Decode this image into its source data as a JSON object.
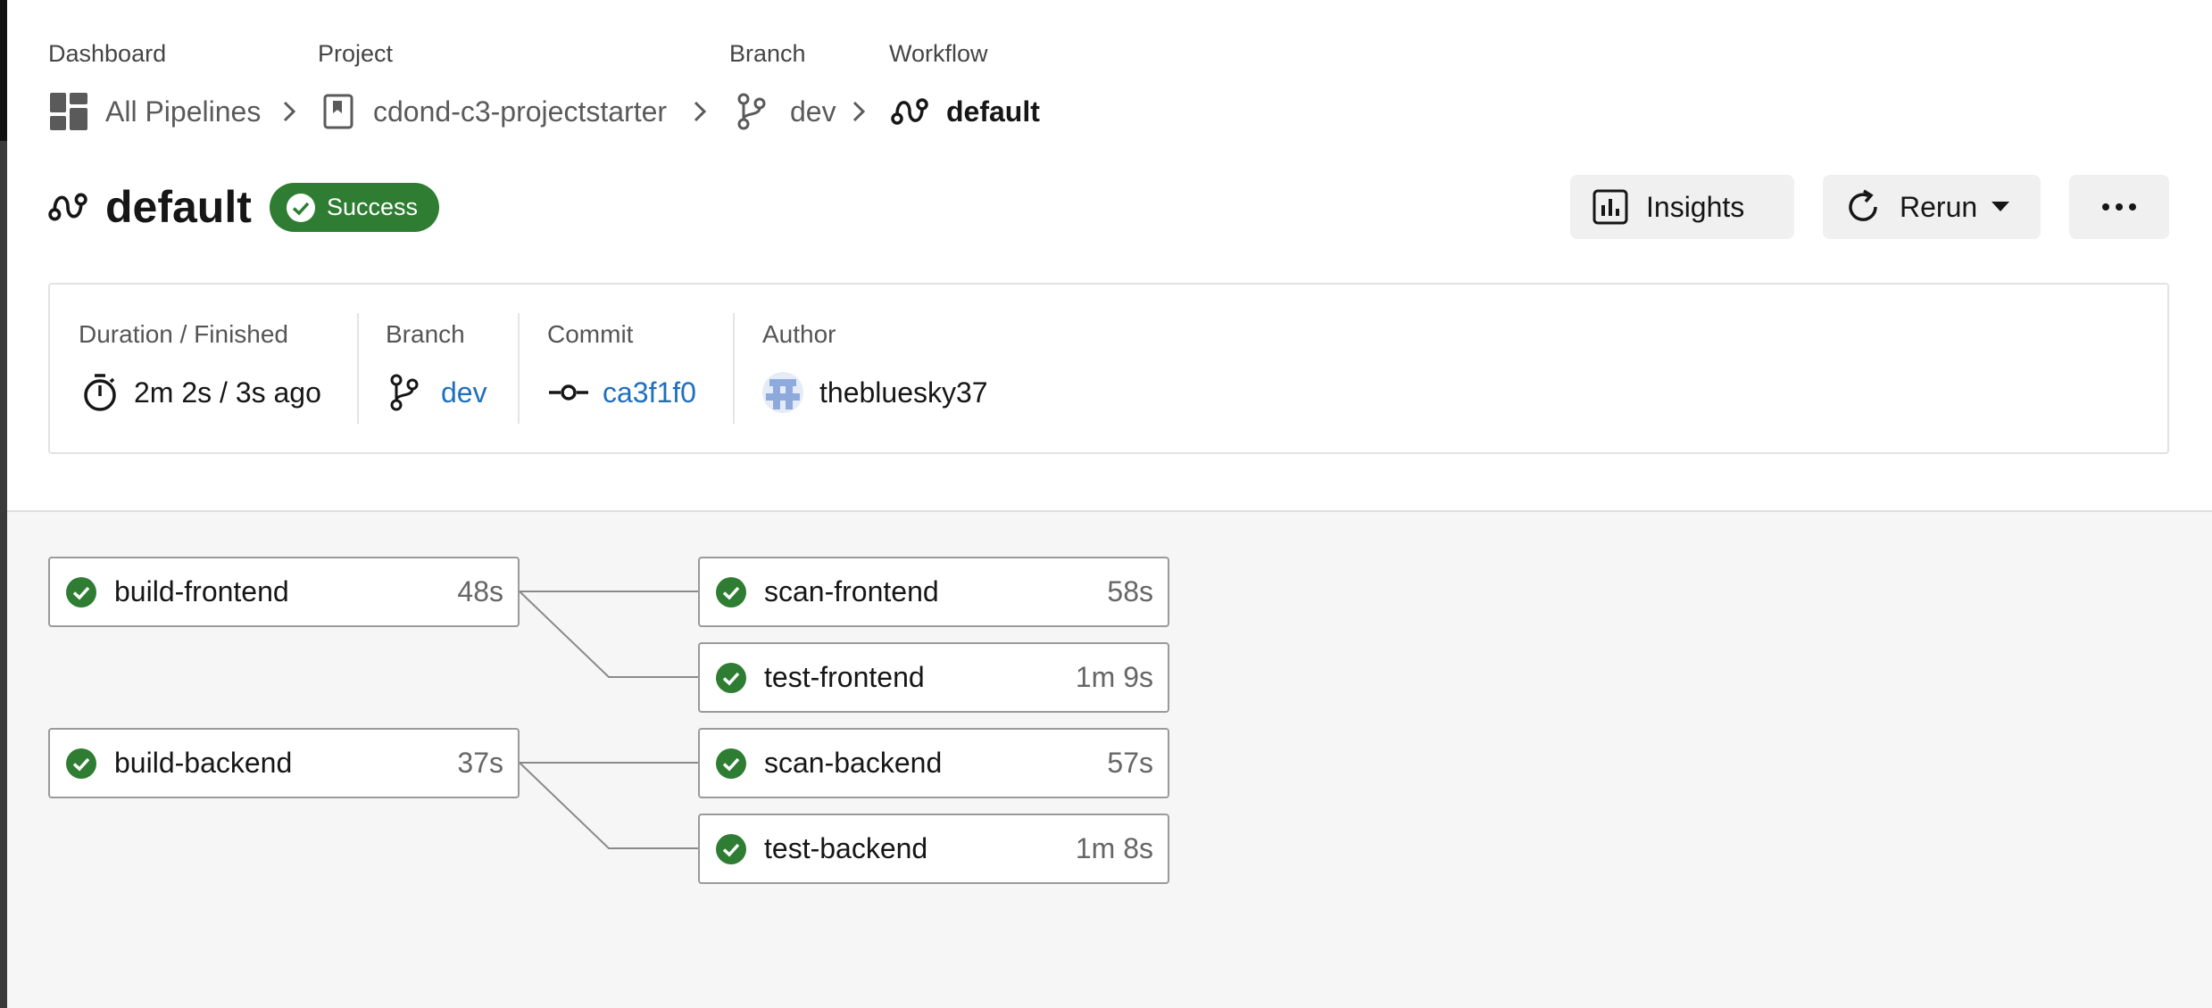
{
  "breadcrumb": {
    "dashboard": {
      "label": "Dashboard",
      "text": "All Pipelines"
    },
    "project": {
      "label": "Project",
      "text": "cdond-c3-projectstarter"
    },
    "branch": {
      "label": "Branch",
      "text": "dev"
    },
    "workflow": {
      "label": "Workflow",
      "text": "default"
    }
  },
  "header": {
    "title": "default",
    "status": "Success",
    "insights_label": "Insights",
    "rerun_label": "Rerun",
    "more_icon": "ellipsis-icon"
  },
  "info": {
    "duration_label": "Duration / Finished",
    "duration_value": "2m 2s / 3s ago",
    "branch_label": "Branch",
    "branch_value": "dev",
    "commit_label": "Commit",
    "commit_value": "ca3f1f0",
    "author_label": "Author",
    "author_value": "thebluesky37"
  },
  "jobs": [
    {
      "name": "build-frontend",
      "duration": "48s",
      "status": "success"
    },
    {
      "name": "scan-frontend",
      "duration": "58s",
      "status": "success"
    },
    {
      "name": "test-frontend",
      "duration": "1m 9s",
      "status": "success"
    },
    {
      "name": "build-backend",
      "duration": "37s",
      "status": "success"
    },
    {
      "name": "scan-backend",
      "duration": "57s",
      "status": "success"
    },
    {
      "name": "test-backend",
      "duration": "1m 8s",
      "status": "success"
    }
  ],
  "colors": {
    "success": "#2e7d32",
    "link": "#1f6fbf",
    "graph_background": "#f6f6f6"
  }
}
